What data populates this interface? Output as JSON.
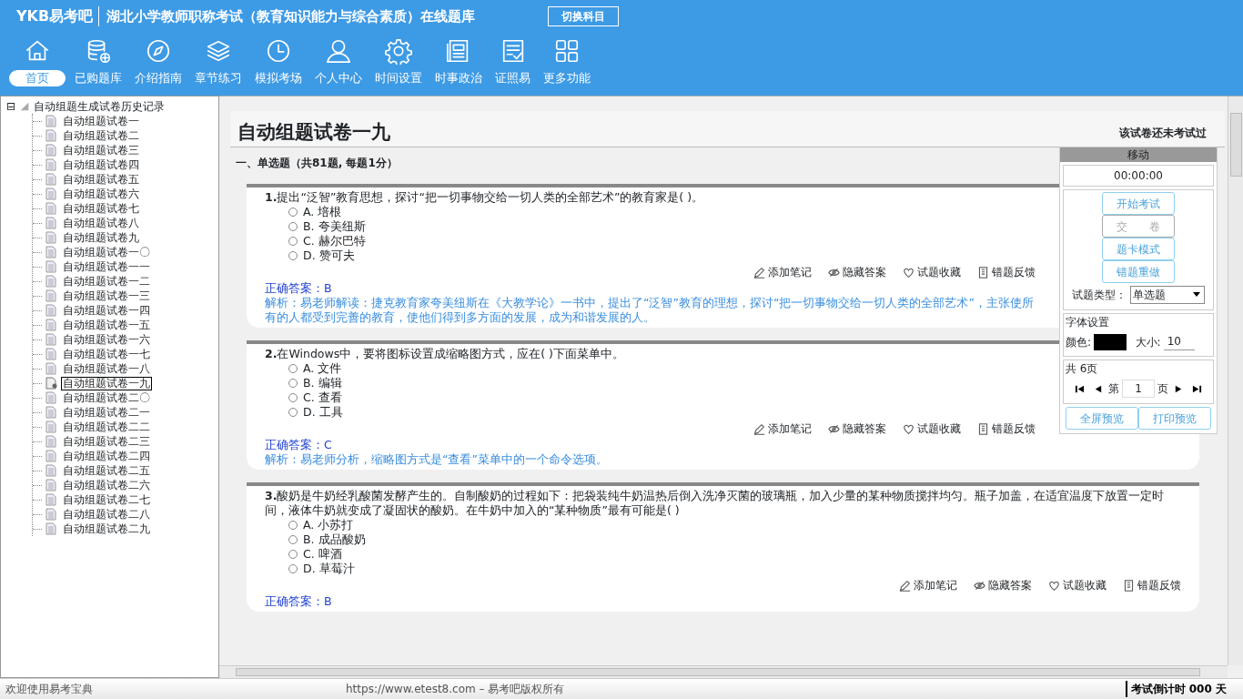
{
  "header": {
    "logo": "YKB易考吧",
    "title": "湖北小学教师职称考试（教育知识能力与综合素质）在线题库",
    "switch_button": "切换科目"
  },
  "nav": [
    {
      "label": "首页",
      "selected": true
    },
    {
      "label": "已购题库",
      "selected": false
    },
    {
      "label": "介绍指南",
      "selected": false
    },
    {
      "label": "章节练习",
      "selected": false
    },
    {
      "label": "模拟考场",
      "selected": false
    },
    {
      "label": "个人中心",
      "selected": false
    },
    {
      "label": "时间设置",
      "selected": false
    },
    {
      "label": "时事政治",
      "selected": false
    },
    {
      "label": "证照易",
      "selected": false
    },
    {
      "label": "更多功能",
      "selected": false
    }
  ],
  "tree": {
    "expander": "⊟",
    "root": "自动组题生成试卷历史记录",
    "children": [
      {
        "label": "自动组题试卷一",
        "selected": false
      },
      {
        "label": "自动组题试卷二",
        "selected": false
      },
      {
        "label": "自动组题试卷三",
        "selected": false
      },
      {
        "label": "自动组题试卷四",
        "selected": false
      },
      {
        "label": "自动组题试卷五",
        "selected": false
      },
      {
        "label": "自动组题试卷六",
        "selected": false
      },
      {
        "label": "自动组题试卷七",
        "selected": false
      },
      {
        "label": "自动组题试卷八",
        "selected": false
      },
      {
        "label": "自动组题试卷九",
        "selected": false
      },
      {
        "label": "自动组题试卷一〇",
        "selected": false
      },
      {
        "label": "自动组题试卷一一",
        "selected": false
      },
      {
        "label": "自动组题试卷一二",
        "selected": false
      },
      {
        "label": "自动组题试卷一三",
        "selected": false
      },
      {
        "label": "自动组题试卷一四",
        "selected": false
      },
      {
        "label": "自动组题试卷一五",
        "selected": false
      },
      {
        "label": "自动组题试卷一六",
        "selected": false
      },
      {
        "label": "自动组题试卷一七",
        "selected": false
      },
      {
        "label": "自动组题试卷一八",
        "selected": false
      },
      {
        "label": "自动组题试卷一九",
        "selected": true
      },
      {
        "label": "自动组题试卷二〇",
        "selected": false
      },
      {
        "label": "自动组题试卷二一",
        "selected": false
      },
      {
        "label": "自动组题试卷二二",
        "selected": false
      },
      {
        "label": "自动组题试卷二三",
        "selected": false
      },
      {
        "label": "自动组题试卷二四",
        "selected": false
      },
      {
        "label": "自动组题试卷二五",
        "selected": false
      },
      {
        "label": "自动组题试卷二六",
        "selected": false
      },
      {
        "label": "自动组题试卷二七",
        "selected": false
      },
      {
        "label": "自动组题试卷二八",
        "selected": false
      },
      {
        "label": "自动组题试卷二九",
        "selected": false
      }
    ]
  },
  "paper": {
    "title": "自动组题试卷一九",
    "status": "该试卷还未考试过",
    "section": "一、单选题（共81题, 每题1分）"
  },
  "questions": [
    {
      "number": "1.",
      "text": "提出“泛智”教育思想，探讨“把一切事物交给一切人类的全部艺术”的教育家是( )。",
      "options": [
        {
          "letter": "A.",
          "text": "培根",
          "selected": false
        },
        {
          "letter": "B.",
          "text": "夸美纽斯",
          "selected": false
        },
        {
          "letter": "C.",
          "text": "赫尔巴特",
          "selected": false
        },
        {
          "letter": "D.",
          "text": "赞可夫",
          "selected": false
        }
      ],
      "actions": [
        "添加笔记",
        "隐藏答案",
        "试题收藏",
        "错题反馈"
      ],
      "answer_label": "正确答案：",
      "answer": "B",
      "analysis": "解析：易老师解读：捷克教育家夸美纽斯在《大教学论》一书中，提出了“泛智”教育的理想，探讨“把一切事物交给一切人类的全部艺术”，主张使所有的人都受到完善的教育，使他们得到多方面的发展，成为和谐发展的人。"
    },
    {
      "number": "2.",
      "text": "在Windows中，要将图标设置成缩略图方式，应在( )下面菜单中。",
      "options": [
        {
          "letter": "A.",
          "text": "文件",
          "selected": false
        },
        {
          "letter": "B.",
          "text": "编辑",
          "selected": false
        },
        {
          "letter": "C.",
          "text": "查看",
          "selected": false
        },
        {
          "letter": "D.",
          "text": "工具",
          "selected": false
        }
      ],
      "actions": [
        "添加笔记",
        "隐藏答案",
        "试题收藏",
        "错题反馈"
      ],
      "answer_label": "正确答案：",
      "answer": "C",
      "analysis": "解析：易老师分析，缩略图方式是“查看”菜单中的一个命令选项。"
    },
    {
      "number": "3.",
      "text": "酸奶是牛奶经乳酸菌发酵产生的。自制酸奶的过程如下：把袋装纯牛奶温热后倒入洗净灭菌的玻璃瓶，加入少量的某种物质搅拌均匀。瓶子加盖，在适宜温度下放置一定时间，液体牛奶就变成了凝固状的酸奶。在牛奶中加入的“某种物质”最有可能是( )",
      "options": [
        {
          "letter": "A.",
          "text": "小苏打",
          "selected": false
        },
        {
          "letter": "B.",
          "text": "成品酸奶",
          "selected": false
        },
        {
          "letter": "C.",
          "text": "啤酒",
          "selected": false
        },
        {
          "letter": "D.",
          "text": "草莓汁",
          "selected": false
        }
      ],
      "actions": [
        "添加笔记",
        "隐藏答案",
        "试题收藏",
        "错题反馈"
      ],
      "answer_label": "正确答案：",
      "answer": "B"
    }
  ],
  "panel": {
    "title": "移动",
    "timer": "00:00:00",
    "buttons": [
      {
        "label": "开始考试",
        "disabled": false
      },
      {
        "label": "交　　卷",
        "disabled": true
      },
      {
        "label": "题卡模式",
        "disabled": false
      },
      {
        "label": "错题重做",
        "disabled": false
      }
    ],
    "type_label": "试题类型：",
    "type_value": "单选题",
    "font_legend": "字体设置",
    "color_label": "颜色:",
    "color": "#000000",
    "size_label": "大小:",
    "size": "10",
    "pages_legend": "共 6页",
    "page_prefix": "第",
    "page": "1",
    "page_suffix": "页",
    "bottom_buttons": [
      {
        "label": "全屏预览",
        "disabled": false
      },
      {
        "label": "打印预览",
        "disabled": false
      }
    ]
  },
  "status_bar": {
    "welcome": "欢迎使用易考宝典",
    "copyright": "https://www.etest8.com – 易考吧版权所有",
    "countdown": "考试倒计时 000 天"
  }
}
